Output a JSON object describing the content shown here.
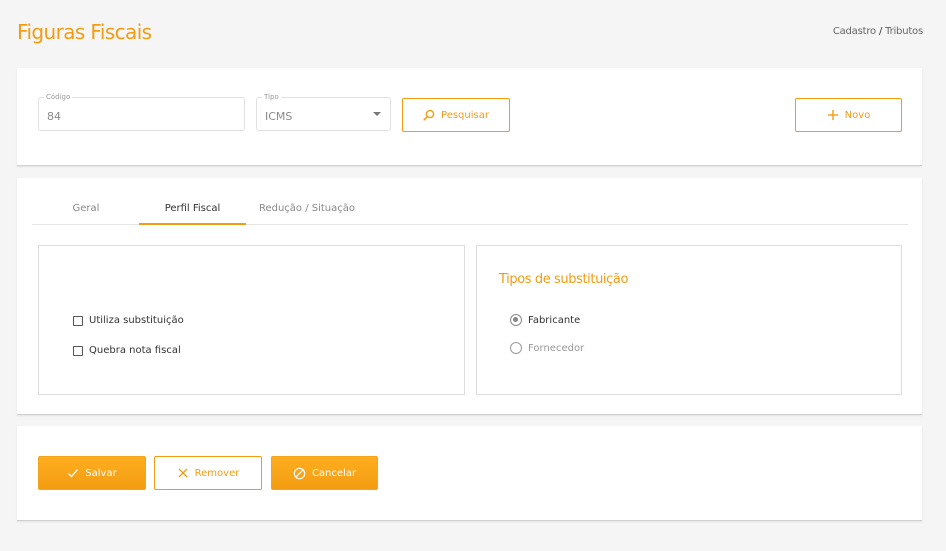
{
  "header": {
    "title": "Figuras Fiscais",
    "breadcrumb": {
      "parent": "Cadastro",
      "separator": "/",
      "current": "Tributos"
    }
  },
  "search": {
    "code_label": "Código",
    "code_value": "84",
    "type_label": "Tipo",
    "type_value": "ICMS",
    "search_button": "Pesquisar",
    "new_button": "Novo"
  },
  "tabs": [
    {
      "label": "Geral"
    },
    {
      "label": "Perfil Fiscal"
    },
    {
      "label": "Redução / Situação"
    }
  ],
  "active_tab": "Perfil Fiscal",
  "left_panel": {
    "checkboxes": [
      {
        "label": "Utiliza substituição",
        "checked": false
      },
      {
        "label": "Quebra nota fiscal",
        "checked": false
      }
    ]
  },
  "right_panel": {
    "title": "Tipos de substituição",
    "options": [
      {
        "label": "Fabricante",
        "selected": true
      },
      {
        "label": "Fornecedor",
        "selected": false
      }
    ]
  },
  "actions": {
    "save": "Salvar",
    "remove": "Remover",
    "cancel": "Cancelar"
  },
  "colors": {
    "accent": "#f39c12",
    "background": "#f5f5f5"
  },
  "icons": {
    "search": "search-icon",
    "new": "plus-icon",
    "save": "check-icon",
    "remove": "close-icon",
    "cancel": "cancel-icon",
    "dropdown": "chevron-down-icon"
  }
}
